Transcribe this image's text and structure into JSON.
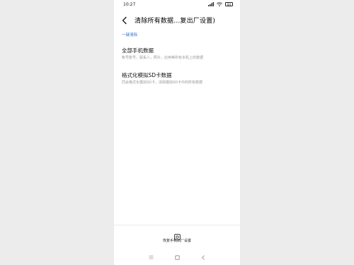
{
  "status_bar": {
    "time": "10:27",
    "battery": "84"
  },
  "header": {
    "title": "清除所有数据…复出厂设置)"
  },
  "section": {
    "label": "一键清除"
  },
  "options": [
    {
      "title": "全部手机数据",
      "description": "帐号账号，联系人，照片，应用等所有本机上的数据"
    },
    {
      "title": "格式化模拟SD卡数据",
      "description": "同会格式化模拟SD卡，清除模拟SD卡中的所有数据"
    }
  ],
  "footer": {
    "reset_label": "恢复手机出厂设置"
  },
  "colors": {
    "accent": "#3a74c9",
    "background": "#ffffff",
    "outer_background": "#ececec"
  }
}
